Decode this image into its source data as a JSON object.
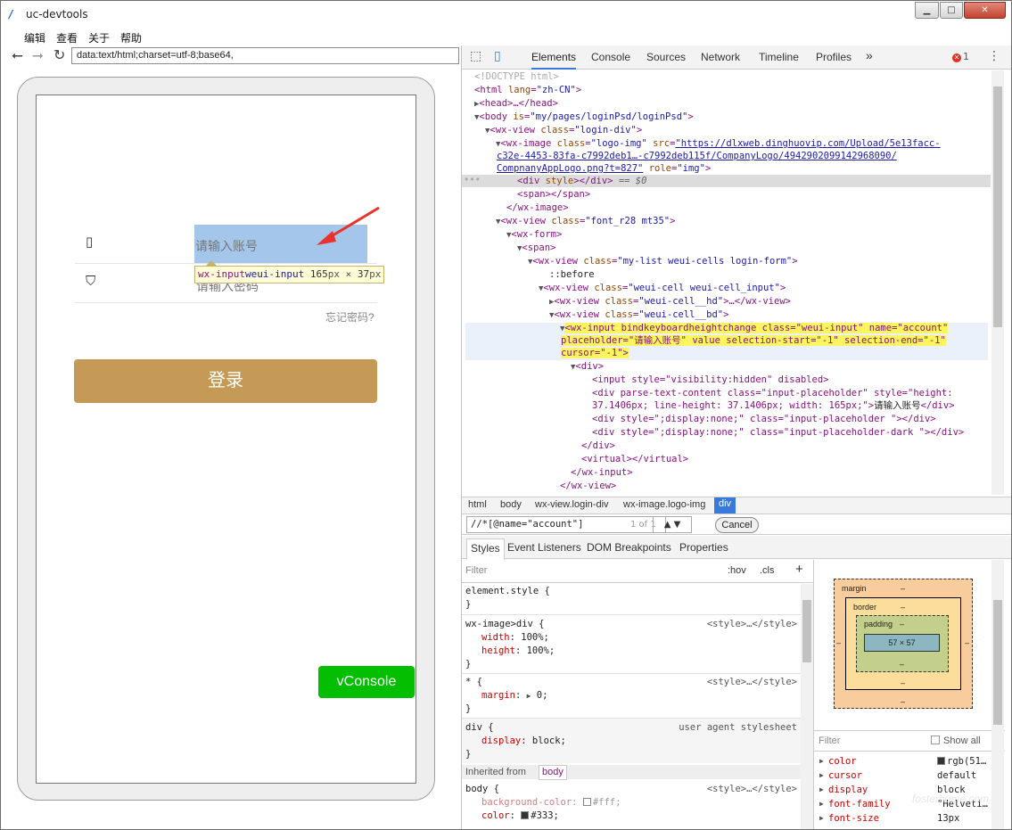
{
  "window": {
    "title": "uc-devtools",
    "minimize": "▁",
    "maximize": "□",
    "close": "✕"
  },
  "menu": {
    "items": [
      "编辑",
      "查看",
      "关于",
      "帮助"
    ]
  },
  "nav": {
    "url": "data:text/html;charset=utf-8;base64,",
    "back_icon": "arrow-left-icon",
    "forward_icon": "arrow-right-icon",
    "reload_icon": "reload-icon"
  },
  "page": {
    "account_placeholder": "请输入账号",
    "password_placeholder": "请输入密码",
    "forgot": "忘记密码?",
    "login": "登录",
    "vconsole": "vConsole",
    "tooltip": {
      "tag": "wx-input",
      "class": "weui-input",
      "size": "165",
      "unit1": "px",
      "times": " × ",
      "size2": "37",
      "unit2": "px"
    },
    "accent": "#c49a56",
    "vconsole_color": "#04be02"
  },
  "devtools": {
    "tabs": [
      "Elements",
      "Console",
      "Sources",
      "Network",
      "Timeline",
      "Profiles"
    ],
    "more": "»",
    "errors": "1",
    "dom": {
      "doctype": "<!DOCTYPE html>",
      "html_tag": "<html",
      "lang_attr": "lang",
      "lang_val": "\"zh-CN\"",
      "head": "<head>…</head>",
      "body_tag": "<body",
      "is_attr": "is",
      "is_val": "\"my/pages/loginPsd/loginPsd\"",
      "wxview1": "<wx-view",
      "class_attr": "class",
      "login_div": "\"login-div\"",
      "wximage": "<wx-image",
      "logo_img": "\"logo-img\"",
      "src_attr": "src",
      "src_l1": "\"https://dlxweb.dinghuovip.com/Upload/5e13facc-",
      "src_l2": "c32e-4453-83fa-c7992deb1…-c7992deb115f/CompanyLogo/4942902099142968090/",
      "src_l3": "CompnanyAppLogo.png?t=827\"",
      "role_attr": "role",
      "role_val": "\"img\"",
      "div_style": "<div",
      "style_attr": "style",
      "div_close": "</div>",
      "eq0": "== $0",
      "span": "<span></span>",
      "wximage_close": "</wx-image>",
      "font_cls": "\"font_r28 mt35\"",
      "wxform": "<wx-form>",
      "span_open": "<span>",
      "mylist_cls": "\"my-list weui-cells login-form\"",
      "before": "::before",
      "weuicell_cls": "\"weui-cell weui-cell_input\"",
      "hd_cls": "\"weui-cell__hd\"",
      "hd_rest": "…</wx-view>",
      "bd_cls": "\"weui-cell__bd\"",
      "wxinput_l1": "<wx-input bindkeyboardheightchange class=\"weui-input\" name=\"account\"",
      "wxinput_l2": "placeholder=\"请输入账号\" value selection-start=\"-1\" selection-end=\"-1\"",
      "wxinput_l3": "cursor=\"-1\">",
      "div_open": "<div>",
      "input_line": "<input style=\"visibility:hidden\" disabled>",
      "ph_l1": "<div parse-text-content class=\"input-placeholder\" style=\"height:",
      "ph_l2a": "37.1406px; line-height: 37.1406px; width: 165px;\">",
      "ph_l2b": "请输入账号",
      "ph_l2c": "</div>",
      "ph2": "<div style=\";display:none;\" class=\"input-placeholder \"></div>",
      "ph3": "<div style=\";display:none;\" class=\"input-placeholder-dark \"></div>",
      "virtual": "<virtual></virtual>",
      "wxinput_close": "</wx-input>",
      "wxview_close": "</wx-view>"
    },
    "breadcrumbs": [
      "html",
      "body",
      "wx-view.login-div",
      "wx-image.logo-img",
      "div"
    ],
    "search": {
      "value": "//*[@name=\"account\"]",
      "count": "1 of 1",
      "nav": "▲ ▼",
      "cancel": "Cancel"
    },
    "subtabs": [
      "Styles",
      "Event Listeners",
      "DOM Breakpoints",
      "Properties"
    ],
    "styles": {
      "filter": "Filter",
      "hov": ":hov",
      "cls": ".cls",
      "plus": "+",
      "element_style": "element.style {",
      "close": "}",
      "rule1_sel": "wx-image>div {",
      "rule1_src": "<style>…</style>",
      "rule1_p1n": "width",
      "rule1_p1v": "100%;",
      "rule1_p2n": "height",
      "rule1_p2v": "100%;",
      "rule2_sel": "* {",
      "rule2_src": "<style>…</style>",
      "rule2_pn": "margin",
      "rule2_pv": "0;",
      "rule3_sel": "div {",
      "rule3_src": "user agent stylesheet",
      "rule3_pn": "display",
      "rule3_pv": "block;",
      "inherited_label": "Inherited from",
      "inherited_from": "body",
      "rule4_sel": "body {",
      "rule4_src": "<style>…</style>",
      "rule4_p1n": "background-color",
      "rule4_p1v": "#fff;",
      "rule4_p2n": "color",
      "rule4_p2v": "#333;"
    },
    "boxmodel": {
      "margin": "margin",
      "border": "border",
      "padding": "padding",
      "dash": "–",
      "content": "57 × 57"
    },
    "computed": {
      "filter": "Filter",
      "show_all": "Show all",
      "rows": [
        {
          "name": "color",
          "value": "rgb(51…"
        },
        {
          "name": "cursor",
          "value": "default"
        },
        {
          "name": "display",
          "value": "block"
        },
        {
          "name": "font-family",
          "value": "\"Helveti…"
        },
        {
          "name": "font-size",
          "value": "13px"
        }
      ]
    }
  },
  "watermark": "fosterhome.com"
}
